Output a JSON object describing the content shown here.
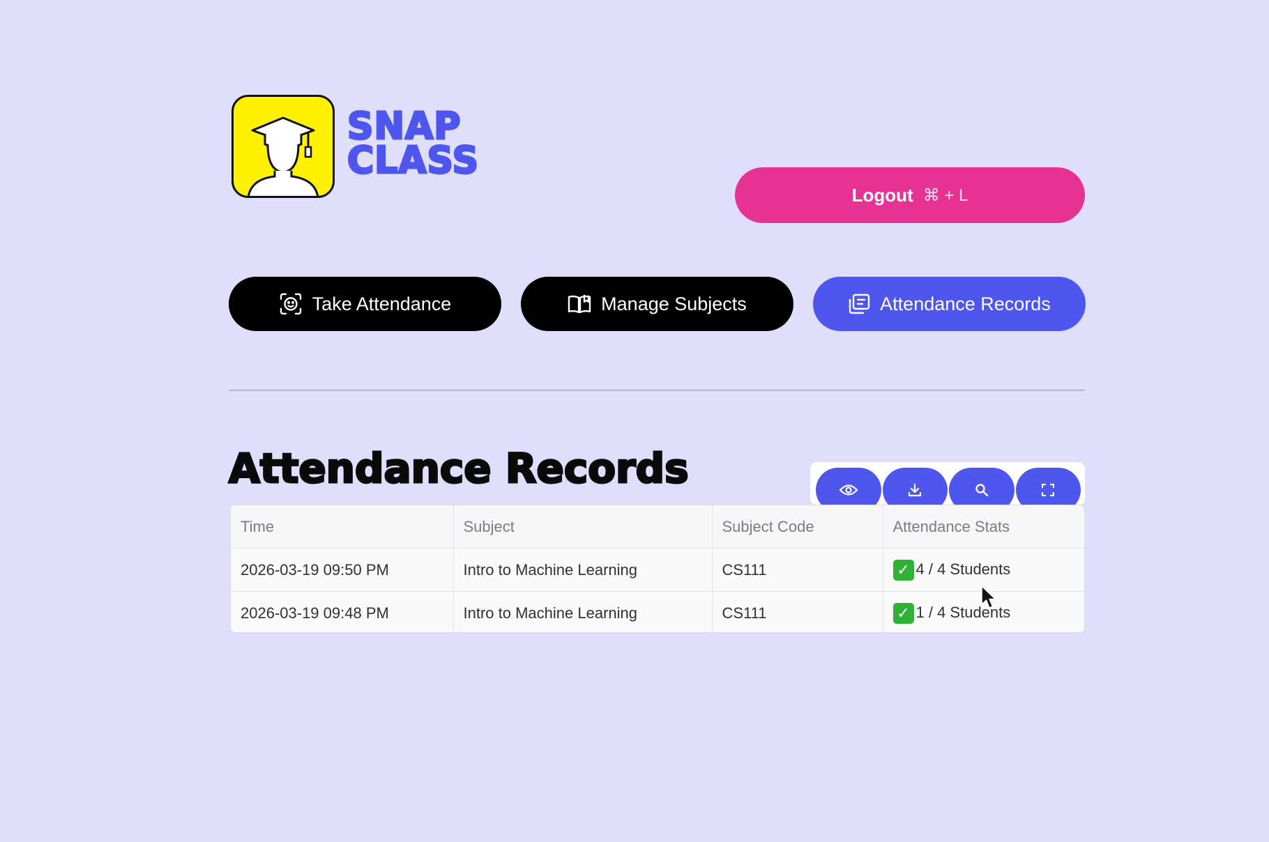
{
  "brand": {
    "line1": "SNAP",
    "line2": "CLASS",
    "logo_icon": "graduate-avatar-icon"
  },
  "header": {
    "logout_label": "Logout",
    "logout_shortcut": "⌘ + L"
  },
  "nav": [
    {
      "label": "Take Attendance",
      "icon": "face-scan-icon"
    },
    {
      "label": "Manage Subjects",
      "icon": "book-open-icon"
    },
    {
      "label": "Attendance Records",
      "icon": "records-icon"
    }
  ],
  "records": {
    "title": "Attendance Records",
    "toolbar": [
      "eye-icon",
      "download-icon",
      "search-icon",
      "fullscreen-icon"
    ],
    "columns": [
      "Time",
      "Subject",
      "Subject Code",
      "Attendance Stats"
    ],
    "rows": [
      [
        "2026-03-19 09:50 PM",
        "Intro to Machine Learning",
        "CS111",
        "4 / 4 Students"
      ],
      [
        "2026-03-19 09:48 PM",
        "Intro to Machine Learning",
        "CS111",
        "1 / 4 Students"
      ]
    ]
  },
  "colors": {
    "background": "#dfdffc",
    "accent": "#4f56ee",
    "logout": "#e63393",
    "logo_bg": "#fff200",
    "check": "#2eb135"
  }
}
